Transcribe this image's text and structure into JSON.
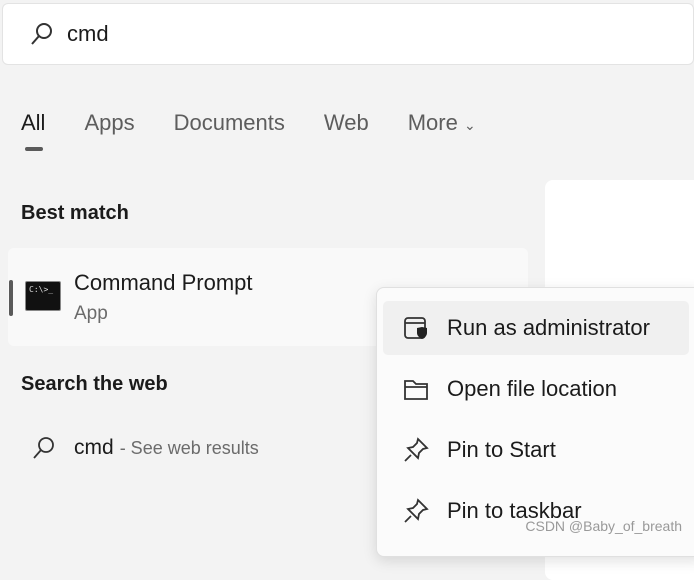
{
  "search": {
    "value": "cmd"
  },
  "tabs": [
    {
      "label": "All",
      "active": true
    },
    {
      "label": "Apps"
    },
    {
      "label": "Documents"
    },
    {
      "label": "Web"
    },
    {
      "label": "More"
    }
  ],
  "best_match": {
    "heading": "Best match",
    "title": "Command Prompt",
    "subtitle": "App",
    "icon_text": "C:\\>_"
  },
  "web": {
    "heading": "Search the web",
    "query": "cmd",
    "suffix": "- See web results"
  },
  "context_menu": [
    {
      "label": "Run as administrator",
      "icon": "shield-window-icon"
    },
    {
      "label": "Open file location",
      "icon": "folder-icon"
    },
    {
      "label": "Pin to Start",
      "icon": "pin-icon"
    },
    {
      "label": "Pin to taskbar",
      "icon": "pin-icon"
    }
  ],
  "watermark": "CSDN @Baby_of_breath"
}
